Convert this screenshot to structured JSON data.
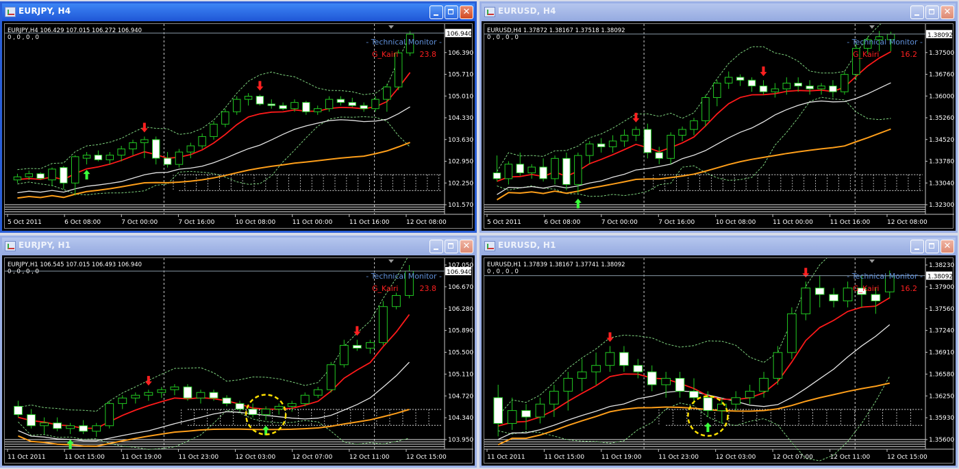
{
  "windows": [
    {
      "id": "w1",
      "title": "EURJPY, H4",
      "symbol_line": "EURJPY,H4  106.429 107.015 106.272 106.940",
      "zeros": "0 , 0 , 0 , 0",
      "monitor": "Technical  Monitor",
      "gk_label": "G_Kairi",
      "gk_value": "23.8",
      "current_price": "106.940",
      "price_labels": [
        "107.070",
        "106.390",
        "105.710",
        "105.010",
        "104.330",
        "103.630",
        "102.950",
        "102.250",
        "101.570"
      ],
      "time_labels": [
        "5 Oct 2011",
        "6 Oct 08:00",
        "7 Oct 00:00",
        "7 Oct 16:00",
        "10 Oct 08:00",
        "11 Oct 00:00",
        "11 Oct 16:00",
        "12 Oct 08:00"
      ]
    },
    {
      "id": "w2",
      "title": "EURUSD, H4",
      "symbol_line": "EURUSD,H4  1.37872 1.38167 1.37518 1.38092",
      "zeros": "0 , 0 , 0 , 0",
      "monitor": "Technical  Monitor",
      "gk_label": "G_Kairi",
      "gk_value": "16.2",
      "current_price": "1.38092",
      "price_labels": [
        "1.38280",
        "1.37500",
        "1.36760",
        "1.36000",
        "1.35260",
        "1.34520",
        "1.33780",
        "1.33040",
        "1.32300"
      ],
      "time_labels": [
        "5 Oct 2011",
        "6 Oct 08:00",
        "7 Oct 00:00",
        "7 Oct 16:00",
        "10 Oct 08:00",
        "11 Oct 00:00",
        "11 Oct 16:00",
        "12 Oct 08:00"
      ]
    },
    {
      "id": "w3",
      "title": "EURJPY, H1",
      "symbol_line": "EURJPY,H1  106.545 107.015 106.493 106.940",
      "zeros": "0 , 0 , 0 , 0",
      "monitor": "Technical  Monitor",
      "gk_label": "G_Kairi",
      "gk_value": "23.8",
      "current_price": "106.940",
      "price_labels": [
        "107.050",
        "106.670",
        "106.280",
        "105.890",
        "105.500",
        "105.110",
        "104.720",
        "104.340",
        "103.950"
      ],
      "time_labels": [
        "11 Oct 2011",
        "11 Oct 15:00",
        "11 Oct 19:00",
        "11 Oct 23:00",
        "12 Oct 03:00",
        "12 Oct 07:00",
        "12 Oct 11:00",
        "12 Oct 15:00"
      ]
    },
    {
      "id": "w4",
      "title": "EURUSD, H1",
      "symbol_line": "EURUSD,H1  1.37839 1.38167 1.37741 1.38092",
      "zeros": "0 , 0 , 0 , 0",
      "monitor": "Technical  Monitor",
      "gk_label": "G_Kairi",
      "gk_value": "16.2",
      "current_price": "1.38092",
      "price_labels": [
        "1.38230",
        "1.37900",
        "1.37560",
        "1.37240",
        "1.36910",
        "1.36580",
        "1.36250",
        "1.35930",
        "1.35600"
      ],
      "time_labels": [
        "11 Oct 2011",
        "11 Oct 15:00",
        "11 Oct 19:00",
        "11 Oct 23:00",
        "12 Oct 03:00",
        "12 Oct 07:00",
        "12 Oct 11:00",
        "12 Oct 15:00"
      ]
    }
  ],
  "chart_data": [
    {
      "type": "candlestick",
      "title": "EURJPY,H4",
      "ylim": [
        101.4,
        107.1
      ],
      "candles": [
        [
          102.2,
          102.4,
          102.1,
          102.3
        ],
        [
          102.3,
          102.5,
          102.2,
          102.4
        ],
        [
          102.4,
          102.45,
          102.2,
          102.25
        ],
        [
          102.2,
          102.6,
          102.0,
          102.55
        ],
        [
          102.6,
          102.65,
          101.9,
          102.1
        ],
        [
          102.1,
          103.0,
          101.7,
          102.95
        ],
        [
          102.9,
          103.1,
          102.7,
          103.0
        ],
        [
          103.0,
          103.15,
          102.8,
          102.85
        ],
        [
          102.85,
          103.1,
          102.7,
          103.0
        ],
        [
          103.0,
          103.3,
          102.8,
          103.2
        ],
        [
          103.2,
          103.5,
          103.0,
          103.4
        ],
        [
          103.4,
          103.6,
          102.9,
          103.5
        ],
        [
          103.5,
          103.6,
          102.7,
          102.9
        ],
        [
          102.9,
          103.1,
          102.6,
          102.7
        ],
        [
          102.7,
          103.2,
          102.6,
          103.1
        ],
        [
          103.1,
          103.4,
          102.9,
          103.3
        ],
        [
          103.3,
          103.7,
          103.2,
          103.6
        ],
        [
          103.6,
          104.1,
          103.5,
          104.0
        ],
        [
          104.0,
          104.5,
          103.9,
          104.4
        ],
        [
          104.4,
          104.9,
          104.3,
          104.8
        ],
        [
          104.8,
          105.0,
          104.6,
          104.9
        ],
        [
          104.9,
          104.95,
          104.6,
          104.65
        ],
        [
          104.65,
          104.8,
          104.5,
          104.6
        ],
        [
          104.6,
          104.7,
          104.45,
          104.5
        ],
        [
          104.5,
          104.8,
          104.4,
          104.7
        ],
        [
          104.7,
          104.75,
          104.3,
          104.4
        ],
        [
          104.4,
          104.6,
          104.3,
          104.5
        ],
        [
          104.5,
          104.9,
          104.4,
          104.8
        ],
        [
          104.8,
          104.9,
          104.6,
          104.7
        ],
        [
          104.7,
          104.85,
          104.55,
          104.6
        ],
        [
          104.6,
          104.7,
          104.4,
          104.5
        ],
        [
          104.5,
          104.9,
          104.4,
          104.8
        ],
        [
          104.8,
          105.3,
          104.4,
          105.2
        ],
        [
          105.2,
          106.4,
          105.1,
          106.3
        ],
        [
          106.3,
          107.0,
          106.2,
          106.9
        ]
      ],
      "up_arrows": [
        6
      ],
      "down_arrows": [
        11,
        21
      ]
    },
    {
      "type": "candlestick",
      "title": "EURUSD,H4",
      "ylim": [
        1.322,
        1.383
      ],
      "candles": [
        [
          1.333,
          1.339,
          1.33,
          1.331
        ],
        [
          1.331,
          1.337,
          1.329,
          1.336
        ],
        [
          1.336,
          1.34,
          1.332,
          1.333
        ],
        [
          1.333,
          1.336,
          1.331,
          1.335
        ],
        [
          1.335,
          1.338,
          1.33,
          1.331
        ],
        [
          1.331,
          1.339,
          1.329,
          1.338
        ],
        [
          1.338,
          1.34,
          1.327,
          1.329
        ],
        [
          1.329,
          1.34,
          1.326,
          1.339
        ],
        [
          1.339,
          1.344,
          1.336,
          1.343
        ],
        [
          1.343,
          1.345,
          1.34,
          1.342
        ],
        [
          1.342,
          1.346,
          1.34,
          1.344
        ],
        [
          1.344,
          1.348,
          1.342,
          1.346
        ],
        [
          1.346,
          1.349,
          1.344,
          1.348
        ],
        [
          1.348,
          1.35,
          1.338,
          1.34
        ],
        [
          1.34,
          1.342,
          1.336,
          1.338
        ],
        [
          1.338,
          1.347,
          1.336,
          1.346
        ],
        [
          1.346,
          1.349,
          1.344,
          1.348
        ],
        [
          1.348,
          1.352,
          1.346,
          1.351
        ],
        [
          1.351,
          1.36,
          1.349,
          1.359
        ],
        [
          1.359,
          1.365,
          1.356,
          1.364
        ],
        [
          1.364,
          1.368,
          1.362,
          1.366
        ],
        [
          1.366,
          1.367,
          1.363,
          1.365
        ],
        [
          1.365,
          1.366,
          1.361,
          1.363
        ],
        [
          1.363,
          1.365,
          1.36,
          1.361
        ],
        [
          1.361,
          1.364,
          1.359,
          1.362
        ],
        [
          1.362,
          1.366,
          1.36,
          1.364
        ],
        [
          1.364,
          1.366,
          1.361,
          1.363
        ],
        [
          1.363,
          1.365,
          1.36,
          1.362
        ],
        [
          1.362,
          1.364,
          1.36,
          1.363
        ],
        [
          1.363,
          1.365,
          1.359,
          1.361
        ],
        [
          1.361,
          1.368,
          1.36,
          1.367
        ],
        [
          1.367,
          1.378,
          1.365,
          1.376
        ],
        [
          1.376,
          1.38,
          1.374,
          1.379
        ],
        [
          1.379,
          1.382,
          1.375,
          1.38
        ],
        [
          1.379,
          1.3817,
          1.375,
          1.3809
        ]
      ],
      "up_arrows": [
        7
      ],
      "down_arrows": [
        12,
        23
      ]
    },
    {
      "type": "candlestick",
      "title": "EURJPY,H1",
      "ylim": [
        103.9,
        107.1
      ],
      "candles": [
        [
          104.5,
          104.6,
          104.3,
          104.35
        ],
        [
          104.35,
          104.45,
          104.1,
          104.15
        ],
        [
          104.15,
          104.3,
          104.0,
          104.2
        ],
        [
          104.2,
          104.3,
          104.05,
          104.1
        ],
        [
          104.1,
          104.2,
          104.0,
          104.15
        ],
        [
          104.15,
          104.25,
          104.0,
          104.05
        ],
        [
          104.05,
          104.2,
          103.95,
          104.15
        ],
        [
          104.15,
          104.6,
          104.1,
          104.55
        ],
        [
          104.55,
          104.7,
          104.45,
          104.65
        ],
        [
          104.65,
          104.75,
          104.55,
          104.7
        ],
        [
          104.7,
          104.8,
          104.6,
          104.75
        ],
        [
          104.75,
          104.85,
          104.65,
          104.8
        ],
        [
          104.8,
          104.9,
          104.7,
          104.85
        ],
        [
          104.85,
          104.9,
          104.6,
          104.65
        ],
        [
          104.65,
          104.8,
          104.55,
          104.75
        ],
        [
          104.75,
          104.8,
          104.6,
          104.65
        ],
        [
          104.65,
          104.7,
          104.5,
          104.55
        ],
        [
          104.55,
          104.6,
          104.4,
          104.45
        ],
        [
          104.45,
          104.55,
          104.3,
          104.35
        ],
        [
          104.35,
          104.5,
          104.25,
          104.45
        ],
        [
          104.45,
          104.55,
          104.35,
          104.5
        ],
        [
          104.5,
          104.6,
          104.4,
          104.55
        ],
        [
          104.55,
          104.75,
          104.5,
          104.7
        ],
        [
          104.7,
          104.85,
          104.65,
          104.8
        ],
        [
          104.8,
          105.3,
          104.75,
          105.25
        ],
        [
          105.25,
          105.7,
          105.2,
          105.6
        ],
        [
          105.6,
          105.7,
          105.5,
          105.55
        ],
        [
          105.55,
          105.7,
          105.45,
          105.65
        ],
        [
          105.65,
          106.4,
          105.6,
          106.3
        ],
        [
          106.3,
          106.55,
          106.25,
          106.5
        ],
        [
          106.5,
          107.05,
          106.45,
          106.94
        ]
      ],
      "up_arrows": [
        4,
        19
      ],
      "down_arrows": [
        10,
        26
      ]
    },
    {
      "type": "candlestick",
      "title": "EURUSD,H1",
      "ylim": [
        1.3555,
        1.383
      ],
      "candles": [
        [
          1.362,
          1.364,
          1.356,
          1.358
        ],
        [
          1.358,
          1.362,
          1.357,
          1.36
        ],
        [
          1.36,
          1.361,
          1.357,
          1.359
        ],
        [
          1.359,
          1.362,
          1.358,
          1.361
        ],
        [
          1.361,
          1.364,
          1.359,
          1.363
        ],
        [
          1.363,
          1.366,
          1.36,
          1.365
        ],
        [
          1.365,
          1.368,
          1.363,
          1.366
        ],
        [
          1.366,
          1.369,
          1.364,
          1.367
        ],
        [
          1.367,
          1.37,
          1.366,
          1.369
        ],
        [
          1.369,
          1.37,
          1.366,
          1.367
        ],
        [
          1.367,
          1.368,
          1.365,
          1.366
        ],
        [
          1.366,
          1.367,
          1.363,
          1.364
        ],
        [
          1.364,
          1.366,
          1.362,
          1.365
        ],
        [
          1.365,
          1.366,
          1.362,
          1.363
        ],
        [
          1.363,
          1.365,
          1.361,
          1.362
        ],
        [
          1.362,
          1.363,
          1.359,
          1.36
        ],
        [
          1.36,
          1.362,
          1.358,
          1.361
        ],
        [
          1.361,
          1.363,
          1.36,
          1.362
        ],
        [
          1.362,
          1.364,
          1.361,
          1.363
        ],
        [
          1.363,
          1.366,
          1.362,
          1.365
        ],
        [
          1.365,
          1.37,
          1.364,
          1.369
        ],
        [
          1.369,
          1.376,
          1.368,
          1.375
        ],
        [
          1.375,
          1.38,
          1.374,
          1.379
        ],
        [
          1.379,
          1.381,
          1.376,
          1.378
        ],
        [
          1.378,
          1.379,
          1.376,
          1.377
        ],
        [
          1.377,
          1.38,
          1.376,
          1.379
        ],
        [
          1.379,
          1.381,
          1.376,
          1.378
        ],
        [
          1.378,
          1.379,
          1.375,
          1.377
        ],
        [
          1.3784,
          1.3817,
          1.3774,
          1.3809
        ]
      ],
      "up_arrows": [
        15
      ],
      "down_arrows": [
        8,
        22
      ]
    }
  ]
}
